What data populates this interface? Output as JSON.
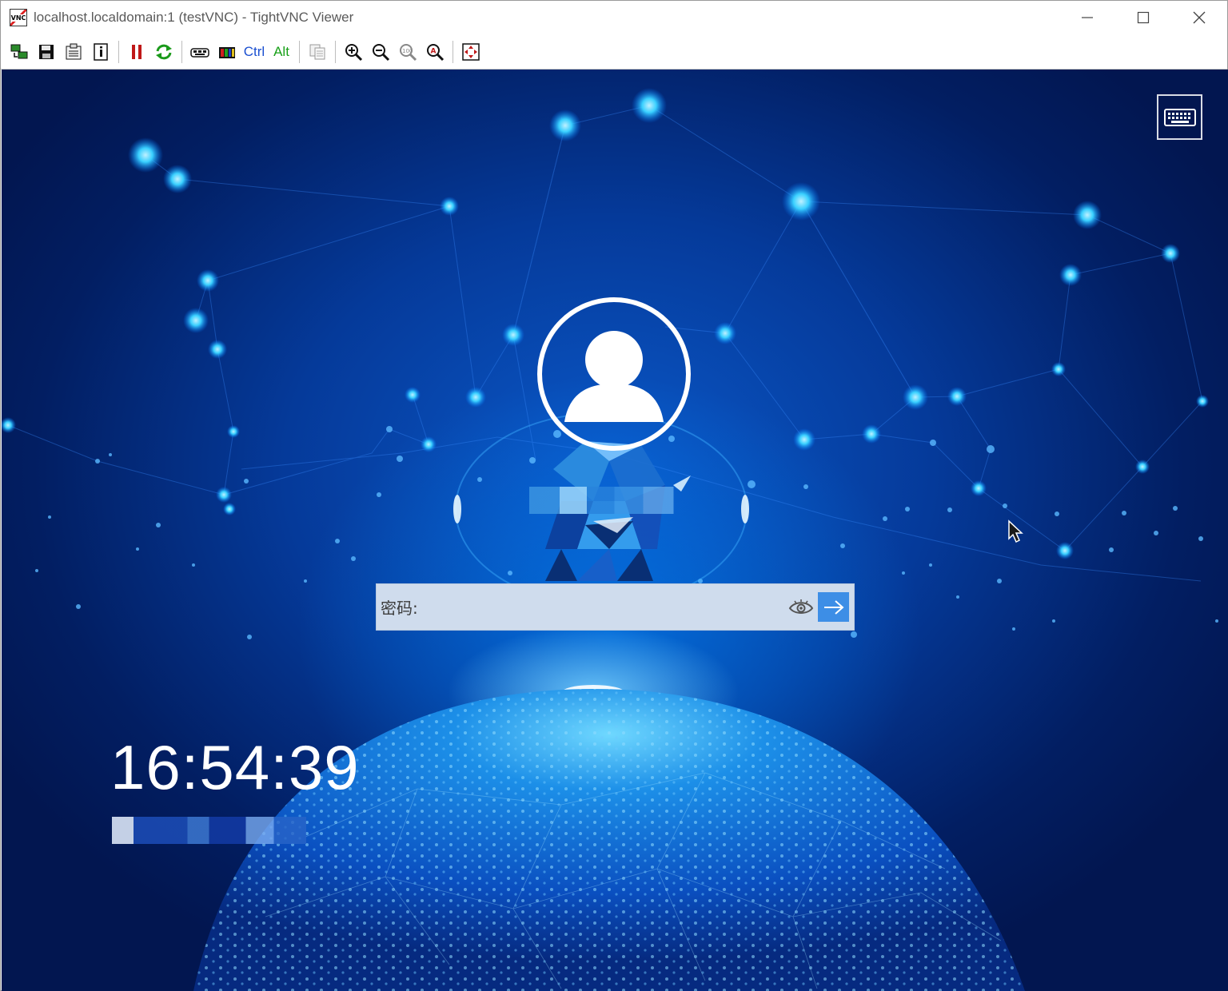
{
  "window": {
    "title": "localhost.localdomain:1 (testVNC) - TightVNC Viewer",
    "app_icon_text": "VNC",
    "controls": [
      "minimize",
      "maximize",
      "close"
    ]
  },
  "toolbar": {
    "buttons": [
      {
        "name": "new-connection",
        "icon": "new-connection-icon"
      },
      {
        "name": "save-session",
        "icon": "floppy-disk-icon"
      },
      {
        "name": "options",
        "icon": "options-icon"
      },
      {
        "name": "connection-info",
        "icon": "info-icon"
      },
      {
        "name": "pause",
        "icon": "pause-icon"
      },
      {
        "name": "refresh",
        "icon": "refresh-icon"
      },
      {
        "name": "ctrl-alt-del",
        "icon": "ctrl-alt-del-icon"
      },
      {
        "name": "ctrl-esc",
        "icon": "ctrl-esc-icon"
      },
      {
        "name": "ctrl",
        "icon": "ctrl-icon"
      },
      {
        "name": "alt",
        "icon": "alt-icon"
      },
      {
        "name": "transfer-files",
        "icon": "file-transfer-icon"
      },
      {
        "name": "zoom-in",
        "icon": "zoom-in-icon"
      },
      {
        "name": "zoom-out",
        "icon": "zoom-out-icon"
      },
      {
        "name": "zoom-100",
        "icon": "zoom-100-icon"
      },
      {
        "name": "zoom-auto",
        "icon": "zoom-auto-icon"
      },
      {
        "name": "full-screen",
        "icon": "full-screen-icon"
      }
    ],
    "ctrl_label": "Ctrl",
    "alt_label": "Alt",
    "ctrl_color": "#1a4fd0",
    "alt_color": "#18a018"
  },
  "login": {
    "password_label": "密码:",
    "password_value": "",
    "submit_color": "#3d8ee6"
  },
  "clock": {
    "time": "16:54:39"
  },
  "colors": {
    "background_dark": "#021e62",
    "background_mid": "#0a58c8",
    "glow": "#78d2ff"
  }
}
